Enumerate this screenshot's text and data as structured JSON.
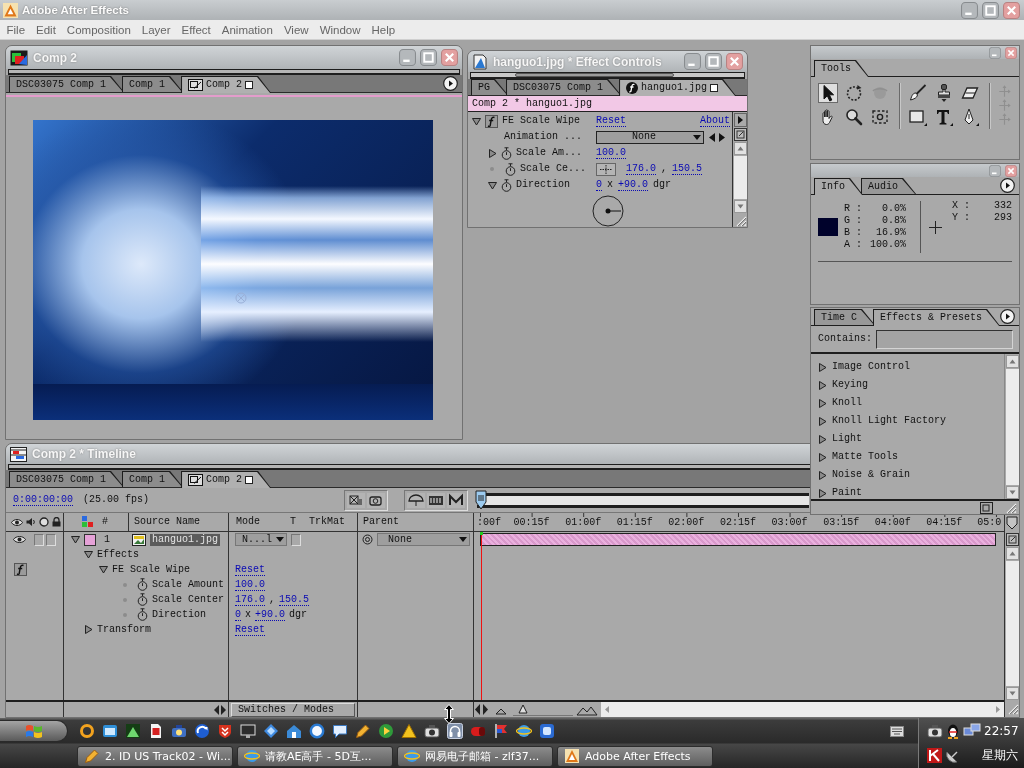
{
  "window": {
    "title": "Adobe After Effects"
  },
  "menu": [
    "File",
    "Edit",
    "Composition",
    "Layer",
    "Effect",
    "Animation",
    "View",
    "Window",
    "Help"
  ],
  "comp_window": {
    "title": "Comp 2",
    "tabs": [
      {
        "label": "DSC03075 Comp 1",
        "selected": false
      },
      {
        "label": "Comp 1",
        "selected": false
      },
      {
        "label": "Comp 2",
        "selected": true
      }
    ]
  },
  "effect_controls": {
    "title": "hanguo1.jpg * Effect Controls",
    "tabs": [
      {
        "label": "PG",
        "selected": false
      },
      {
        "label": "DSC03075 Comp 1",
        "selected": false
      },
      {
        "label": "hanguo1.jpg",
        "selected": true
      }
    ],
    "header": "Comp 2 * hanguo1.jpg",
    "effect": {
      "name": "FE Scale Wipe",
      "expanded": true,
      "enabled": true,
      "reset": "Reset",
      "about": "About"
    },
    "properties": [
      {
        "kind": "dropdown",
        "label": "Animation ...",
        "value": "None"
      },
      {
        "kind": "value",
        "label": "Scale Am...",
        "expanded": false,
        "parts": [
          {
            "text": "100.0",
            "link": true
          }
        ]
      },
      {
        "kind": "point",
        "label": "Scale Ce...",
        "parts": [
          {
            "text": "176.0",
            "link": true
          },
          {
            "text": ",",
            "link": false
          },
          {
            "text": "150.5",
            "link": true
          }
        ]
      },
      {
        "kind": "angle",
        "label": "Direction",
        "expanded": true,
        "parts": [
          {
            "text": "0",
            "link": true
          },
          {
            "text": "x",
            "link": false
          },
          {
            "text": "+90.0",
            "link": true
          },
          {
            "text": "dgr",
            "link": false
          }
        ]
      }
    ]
  },
  "tools_panel": {
    "tabs": [
      {
        "label": "Tools",
        "selected": true
      }
    ],
    "groups": [
      {
        "kind": "grid",
        "tools": [
          {
            "kind": "selection",
            "selected": true,
            "disabled": false
          },
          {
            "kind": "rotation",
            "selected": false,
            "disabled": false
          },
          {
            "kind": "orbit",
            "selected": false,
            "disabled": true
          },
          {
            "kind": "hand",
            "selected": false,
            "disabled": false
          },
          {
            "kind": "zoom",
            "selected": false,
            "disabled": false
          },
          {
            "kind": "pan_behind",
            "selected": false,
            "disabled": false
          }
        ]
      },
      {
        "kind": "grid",
        "tools": [
          {
            "kind": "brush",
            "selected": false,
            "disabled": false
          },
          {
            "kind": "clone_stamp",
            "selected": false,
            "disabled": false
          },
          {
            "kind": "eraser",
            "selected": false,
            "disabled": false
          },
          {
            "kind": "rectangle",
            "selected": false,
            "disabled": false
          },
          {
            "kind": "text",
            "selected": false,
            "disabled": false
          },
          {
            "kind": "pen",
            "selected": false,
            "disabled": false
          }
        ]
      },
      {
        "kind": "stack",
        "tools": [
          {
            "kind": "local_axis",
            "selected": false,
            "disabled": true
          },
          {
            "kind": "world_axis",
            "selected": false,
            "disabled": true
          },
          {
            "kind": "view_axis",
            "selected": false,
            "disabled": true
          }
        ]
      }
    ]
  },
  "info_panel": {
    "tabs": [
      {
        "label": "Info",
        "selected": true
      },
      {
        "label": "Audio",
        "selected": false
      }
    ],
    "swatch": {
      "color": "#00022b"
    },
    "channels": [
      {
        "label": "R :",
        "value": "0.0%"
      },
      {
        "label": "G :",
        "value": "0.8%"
      },
      {
        "label": "B :",
        "value": "16.9%"
      },
      {
        "label": "A :",
        "value": "100.0%"
      }
    ],
    "coordinates": [
      {
        "label": "X :",
        "value": "332"
      },
      {
        "label": "Y :",
        "value": "293"
      }
    ]
  },
  "effects_panel": {
    "tabs": [
      {
        "label": "Time C",
        "selected": false
      },
      {
        "label": "Effects & Presets",
        "selected": true
      }
    ],
    "search": {
      "label": "Contains:"
    },
    "categories": [
      {
        "label": "Image Control",
        "expanded": false
      },
      {
        "label": "Keying",
        "expanded": false
      },
      {
        "label": "Knoll",
        "expanded": false
      },
      {
        "label": "Knoll Light Factory",
        "expanded": false
      },
      {
        "label": "Light",
        "expanded": false
      },
      {
        "label": "Matte Tools",
        "expanded": false
      },
      {
        "label": "Noise & Grain",
        "expanded": false
      },
      {
        "label": "Paint",
        "expanded": false
      }
    ]
  },
  "timeline": {
    "title": "Comp 2 * Timeline",
    "tabs": [
      {
        "label": "DSC03075 Comp 1",
        "selected": false
      },
      {
        "label": "Comp 1",
        "selected": false
      },
      {
        "label": "Comp 2",
        "selected": true
      }
    ],
    "timecode": "0:00:00:00",
    "fps": "(25.00 fps)",
    "columns": {
      "number": "#",
      "source": "Source Name",
      "mode": "Mode",
      "t": "T",
      "track_matte": "TrkMat",
      "parent": "Parent"
    },
    "layers": [
      {
        "number": "1",
        "name": "hanguo1.jpg",
        "selected": true,
        "expanded": true,
        "visible": true,
        "color": "#e6a2d8",
        "mode": "N...l",
        "parent": "None",
        "children": [
          {
            "kind": "group",
            "name": "Effects",
            "expanded": true,
            "children": [
              {
                "kind": "effect",
                "name": "FE Scale Wipe",
                "expanded": true,
                "enabled": true,
                "parts": [
                  {
                    "text": "Reset",
                    "link": true
                  }
                ],
                "children": [
                  {
                    "kind": "property",
                    "name": "Scale Amount",
                    "parts": [
                      {
                        "text": "100.0",
                        "link": true
                      }
                    ]
                  },
                  {
                    "kind": "property",
                    "name": "Scale Center",
                    "parts": [
                      {
                        "text": "176.0",
                        "link": true
                      },
                      {
                        "text": ",",
                        "link": false
                      },
                      {
                        "text": "150.5",
                        "link": true
                      }
                    ]
                  },
                  {
                    "kind": "property",
                    "name": "Direction",
                    "parts": [
                      {
                        "text": "0",
                        "link": true
                      },
                      {
                        "text": "x",
                        "link": false
                      },
                      {
                        "text": "+90.0",
                        "link": true
                      },
                      {
                        "text": "dgr",
                        "link": false
                      }
                    ]
                  }
                ]
              }
            ]
          },
          {
            "kind": "group",
            "name": "Transform",
            "expanded": false,
            "parts": [
              {
                "text": "Reset",
                "link": true
              }
            ]
          }
        ]
      }
    ],
    "ruler": [
      ":00f",
      "00:15f",
      "01:00f",
      "01:15f",
      "02:00f",
      "02:15f",
      "03:00f",
      "03:15f",
      "04:00f",
      "04:15f",
      "05:0"
    ],
    "zoom": {
      "level": 0.08
    },
    "switch_button": "Switches / Modes"
  },
  "taskbar": {
    "tasks": [
      {
        "label": "2. ID US Track02 - Wi..."
      },
      {
        "label": "请教AE高手 - 5D互..."
      },
      {
        "label": "网易电子邮箱 - zlf37..."
      },
      {
        "label": "Adobe After Effects"
      }
    ],
    "clock": {
      "time": "22:57",
      "day": "星期六"
    }
  }
}
